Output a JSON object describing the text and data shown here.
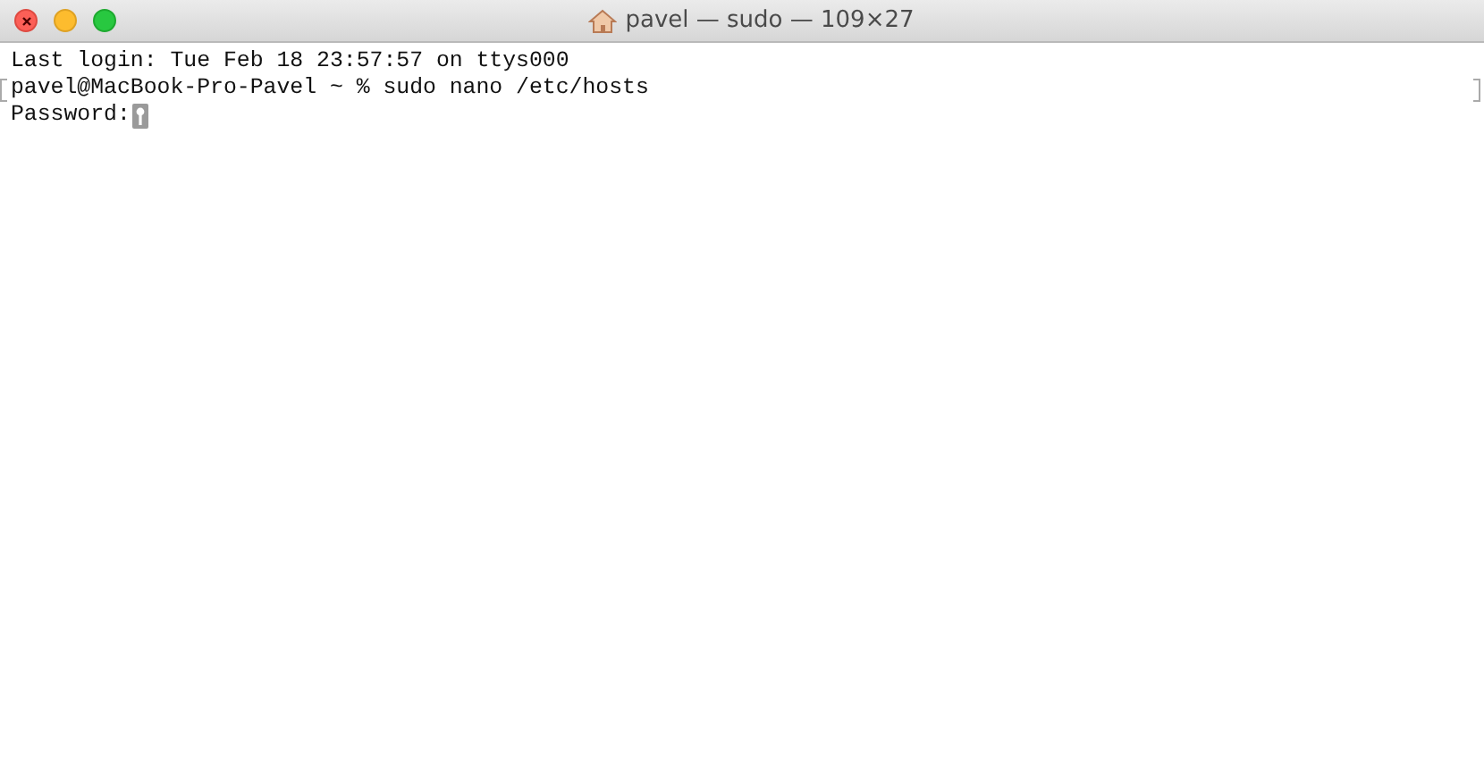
{
  "window": {
    "title": "pavel — sudo — 109×27"
  },
  "terminal": {
    "lines": [
      {
        "text": "Last login: Tue Feb 18 23:57:57 on ttys000",
        "marked": false,
        "cursor": false
      },
      {
        "text": "pavel@MacBook-Pro-Pavel ~ % sudo nano /etc/hosts",
        "marked": true,
        "cursor": false
      },
      {
        "text": "Password:",
        "marked": false,
        "cursor": true
      }
    ]
  }
}
